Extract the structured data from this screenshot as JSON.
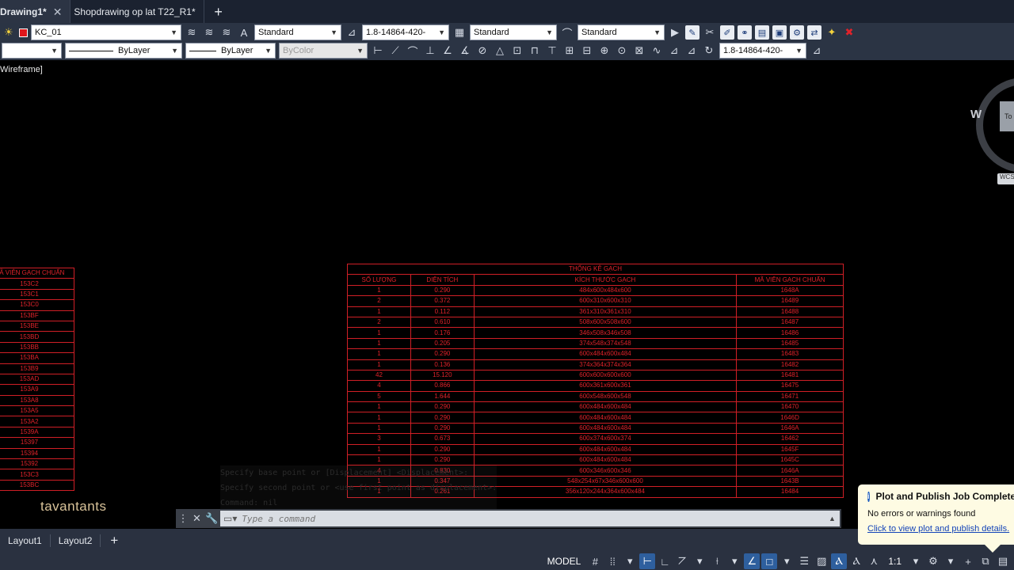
{
  "tabs": [
    {
      "label": "Drawing1*",
      "active": true
    },
    {
      "label": "Shopdrawing op lat T22_R1*",
      "active": false
    }
  ],
  "toolbar1": {
    "layer_name": "KC_01",
    "text_style": "Standard",
    "dim_style": "1.8-14864-420-",
    "table_style": "Standard",
    "mleader_style": "Standard"
  },
  "toolbar2": {
    "layer_combo": "",
    "linetype": "ByLayer",
    "lineweight": "ByLayer",
    "plot_style": "ByColor",
    "dim_style": "1.8-14864-420-"
  },
  "viewport_label": "Wireframe]",
  "viewcube": {
    "west": "W",
    "face": "To",
    "wcs": "WCS"
  },
  "cad_color": "#e0222a",
  "table_main": {
    "title": "THỐNG KÊ GẠCH",
    "headers": [
      "SỐ LƯỢNG",
      "DIỆN TÍCH",
      "KÍCH THƯỚC GẠCH",
      "MÃ VIÊN GẠCH CHUẨN"
    ],
    "rows": [
      [
        "1",
        "0.290",
        "484x600x484x600",
        "1648A"
      ],
      [
        "2",
        "0.372",
        "600x310x600x310",
        "16489"
      ],
      [
        "1",
        "0.112",
        "361x310x361x310",
        "16488"
      ],
      [
        "2",
        "0.610",
        "508x600x508x600",
        "16487"
      ],
      [
        "1",
        "0.176",
        "346x508x346x508",
        "16486"
      ],
      [
        "1",
        "0.205",
        "374x548x374x548",
        "16485"
      ],
      [
        "1",
        "0.290",
        "600x484x600x484",
        "16483"
      ],
      [
        "1",
        "0.136",
        "374x364x374x364",
        "16482"
      ],
      [
        "42",
        "15.120",
        "600x600x600x600",
        "16481"
      ],
      [
        "4",
        "0.866",
        "600x361x600x361",
        "16475"
      ],
      [
        "5",
        "1.644",
        "600x548x600x548",
        "16471"
      ],
      [
        "1",
        "0.290",
        "600x484x600x484",
        "16470"
      ],
      [
        "1",
        "0.290",
        "600x484x600x484",
        "1646D"
      ],
      [
        "1",
        "0.290",
        "600x484x600x484",
        "1646A"
      ],
      [
        "3",
        "0.673",
        "600x374x600x374",
        "16462"
      ],
      [
        "1",
        "0.290",
        "600x484x600x484",
        "1645F"
      ],
      [
        "1",
        "0.290",
        "600x484x600x484",
        "1645C"
      ],
      [
        "4",
        "0.830",
        "600x346x600x346",
        "1646A"
      ],
      [
        "1",
        "0.347",
        "548x254x67x346x600x600",
        "1643B"
      ],
      [
        "1",
        "0.261",
        "356x120x244x364x600x484",
        "16484"
      ]
    ]
  },
  "table_left": {
    "header": "MÃ VIÊN GẠCH CHUẨN",
    "rows": [
      "153C2",
      "153C1",
      "153C0",
      "153BF",
      "153BE",
      "153BD",
      "153BB",
      "153BA",
      "153B9",
      "153AD",
      "153A9",
      "153A8",
      "153A5",
      "153A2",
      "1539A",
      "15397",
      "15394",
      "15392",
      "153C3",
      "153BC"
    ]
  },
  "command_history": [
    "Specify base point or [Displacement] <Displacement>:",
    "Specify second point or <use first point as displacement>:",
    "Command: nil"
  ],
  "watermark": "tavantants",
  "command_placeholder": "Type a command",
  "layout_tabs": [
    "Layout1",
    "Layout2"
  ],
  "status": {
    "model": "MODEL",
    "scale": "1:1"
  },
  "notification": {
    "title": "Plot and Publish Job Complete",
    "message": "No errors or warnings found",
    "link": "Click to view plot and publish details."
  }
}
